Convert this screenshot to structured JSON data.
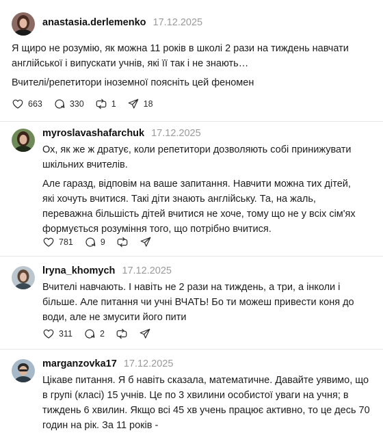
{
  "posts": [
    {
      "username": "anastasia.derlemenko",
      "date": "17.12.2025",
      "paragraphs": [
        "Я щиро не розумію, як можна 11 років в школі 2 рази на тиждень навчати англійської і випускати учнів, які її так і не знають…",
        "Вчителі/репетитори іноземної поясніть цей феномен"
      ],
      "likes": "663",
      "comments": "330",
      "reposts": "1",
      "shares": "18"
    },
    {
      "username": "myroslavashafarchuk",
      "date": "17.12.2025",
      "paragraphs": [
        "Ох, як же ж дратує, коли репетитори дозволяють собі принижувати шкільних вчителів.",
        "Але гаразд, відповім на ваше запитання. Навчити можна тих дітей, які хочуть вчитися. Такі діти знають англійську. Та, на жаль, переважна більшість дітей вчитися не хоче, тому що не у всіх сім'ях формується розуміння того, що потрібно вчитися."
      ],
      "likes": "781",
      "comments": "9",
      "reposts": "",
      "shares": ""
    },
    {
      "username": "lryna_khomych",
      "date": "17.12.2025",
      "paragraphs": [
        "Вчителі навчають. І навіть не 2 рази на тиждень, а три, а інколи і більше. Але питання чи учні ВЧАТЬ! Бо ти можеш привести коня до води, але не змусити його пити"
      ],
      "likes": "311",
      "comments": "2",
      "reposts": "",
      "shares": ""
    },
    {
      "username": "marganzovka17",
      "date": "17.12.2025",
      "paragraphs": [
        "Цікаве питання. Я б навіть сказала, математичне. Давайте уявимо, що в групі (класі) 15 учнів. Це по 3 хвилини особистої уваги на учня; в тиждень 6 хвилин. Якщо всі 45 хв учень працює активно, то це десь 70 годин на рік. За 11 років -"
      ]
    }
  ]
}
